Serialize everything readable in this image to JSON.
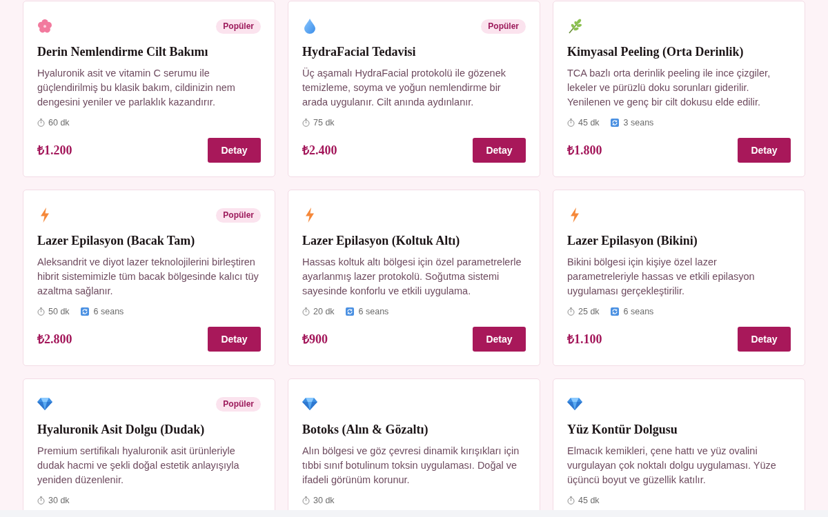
{
  "cards": [
    {
      "kind": "flower",
      "badge": "Popüler",
      "title": "Derin Nemlendirme Cilt Bakımı",
      "description": "Hyaluronik asit ve vitamin C serumu ile güçlendirilmiş bu klasik bakım, cildinizin nem dengesini yeniler ve parlaklık kazandırır.",
      "duration": "60 dk",
      "price": "₺1.200",
      "button": "Detay"
    },
    {
      "kind": "drop",
      "badge": "Popüler",
      "title": "HydraFacial Tedavisi",
      "description": "Üç aşamalı HydraFacial protokolü ile gözenek temizleme, soyma ve yoğun nemlendirme bir arada uygulanır. Cilt anında aydınlanır.",
      "duration": "75 dk",
      "price": "₺2.400",
      "button": "Detay"
    },
    {
      "kind": "leaf",
      "title": "Kimyasal Peeling (Orta Derinlik)",
      "description": "TCA bazlı orta derinlik peeling ile ince çizgiler, lekeler ve pürüzlü doku sorunları giderilir. Yenilenen ve genç bir cilt dokusu elde edilir.",
      "duration": "45 dk",
      "sessions": "3 seans",
      "price": "₺1.800",
      "button": "Detay"
    },
    {
      "kind": "bolt",
      "badge": "Popüler",
      "title": "Lazer Epilasyon (Bacak Tam)",
      "description": "Aleksandrit ve diyot lazer teknolojilerini birleştiren hibrit sistemimizle tüm bacak bölgesinde kalıcı tüy azaltma sağlanır.",
      "duration": "50 dk",
      "sessions": "6 seans",
      "price": "₺2.800",
      "button": "Detay"
    },
    {
      "kind": "bolt",
      "title": "Lazer Epilasyon (Koltuk Altı)",
      "description": "Hassas koltuk altı bölgesi için özel parametrelerle ayarlanmış lazer protokolü. Soğutma sistemi sayesinde konforlu ve etkili uygulama.",
      "duration": "20 dk",
      "sessions": "6 seans",
      "price": "₺900",
      "button": "Detay"
    },
    {
      "kind": "bolt",
      "title": "Lazer Epilasyon (Bikini)",
      "description": "Bikini bölgesi için kişiye özel lazer parametreleriyle hassas ve etkili epilasyon uygulaması gerçekleştirilir.",
      "duration": "25 dk",
      "sessions": "6 seans",
      "price": "₺1.100",
      "button": "Detay"
    },
    {
      "kind": "gem",
      "badge": "Popüler",
      "title": "Hyaluronik Asit Dolgu (Dudak)",
      "description": "Premium sertifikalı hyaluronik asit ürünleriyle dudak hacmi ve şekli doğal estetik anlayışıyla yeniden düzenlenir.",
      "duration": "30 dk"
    },
    {
      "kind": "gem",
      "title": "Botoks (Alın & Gözaltı)",
      "description": "Alın bölgesi ve göz çevresi dinamik kırışıkları için tıbbi sınıf botulinum toksin uygulaması. Doğal ve ifadeli görünüm korunur.",
      "duration": "30 dk"
    },
    {
      "kind": "gem",
      "title": "Yüz Kontür Dolgusu",
      "description": "Elmacık kemikleri, çene hattı ve yüz ovalini vurgulayan çok noktalı dolgu uygulaması. Yüze üçüncü boyut ve güzellik katılır.",
      "duration": "45 dk"
    }
  ]
}
